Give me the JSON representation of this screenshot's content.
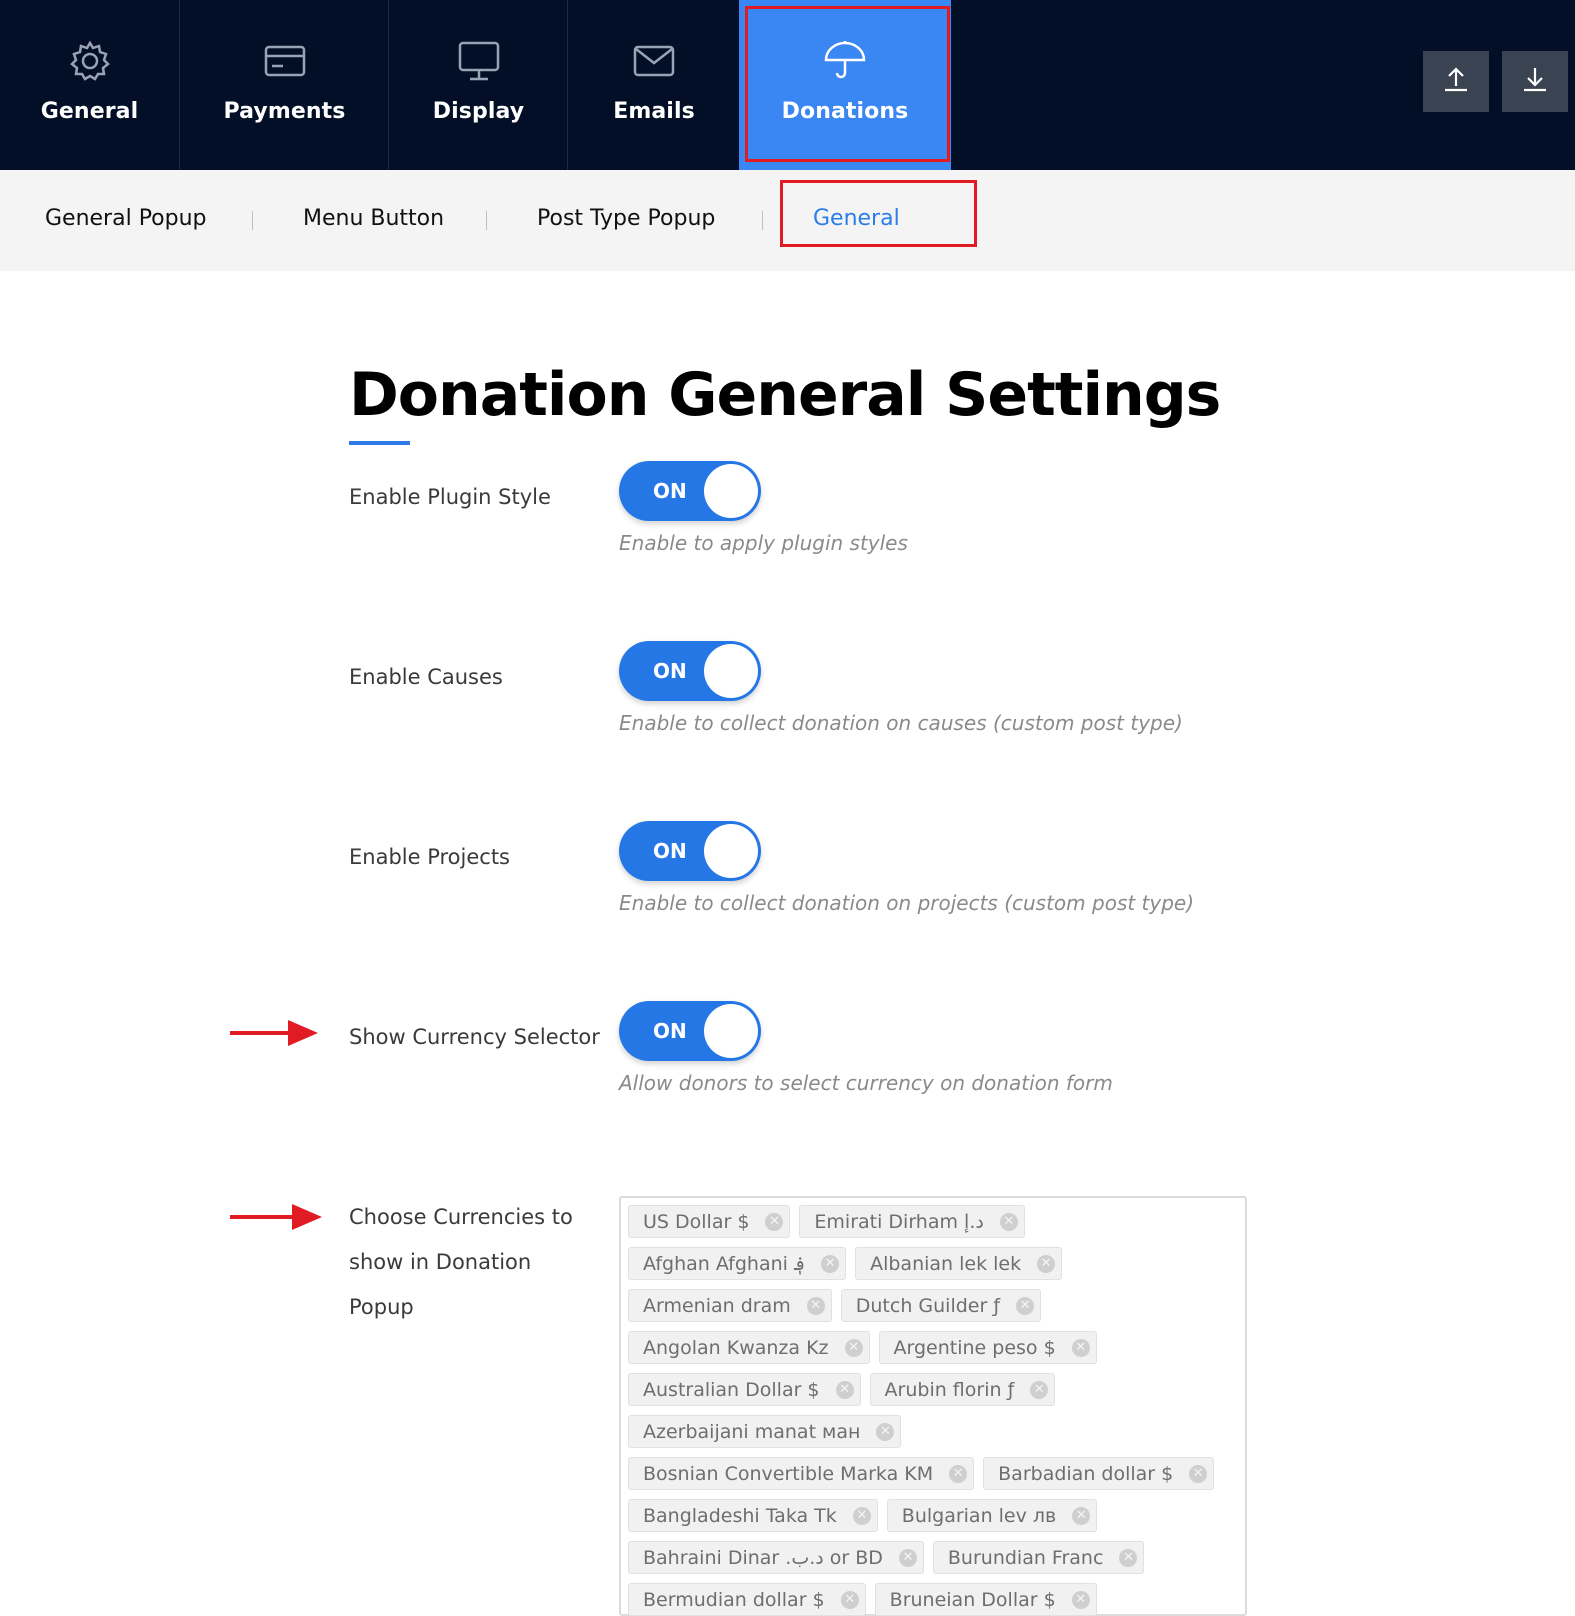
{
  "top_tabs": [
    {
      "label": "General",
      "icon": "gear-icon"
    },
    {
      "label": "Payments",
      "icon": "credit-card-icon"
    },
    {
      "label": "Display",
      "icon": "monitor-icon"
    },
    {
      "label": "Emails",
      "icon": "envelope-icon"
    },
    {
      "label": "Donations",
      "icon": "umbrella-icon",
      "active": true
    }
  ],
  "toolbar": {
    "export_icon": "upload-icon",
    "import_icon": "download-icon"
  },
  "sub_tabs": [
    {
      "label": "General Popup"
    },
    {
      "label": "Menu Button"
    },
    {
      "label": "Post Type Popup"
    },
    {
      "label": "General",
      "active": true
    }
  ],
  "page": {
    "title": "Donation General Settings"
  },
  "settings": [
    {
      "label": "Enable Plugin Style",
      "state": "ON",
      "description": "Enable to apply plugin styles"
    },
    {
      "label": "Enable Causes",
      "state": "ON",
      "description": "Enable to collect donation on causes (custom post type)"
    },
    {
      "label": "Enable Projects",
      "state": "ON",
      "description": "Enable to collect donation on projects (custom post type)"
    },
    {
      "label": "Show Currency Selector",
      "state": "ON",
      "description": "Allow donors to select currency on donation form"
    }
  ],
  "currencies_setting": {
    "label_lines": [
      "Choose Currencies to",
      "show in Donation",
      "Popup"
    ],
    "chips": [
      "US Dollar $",
      "Emirati Dirham د.إ",
      "Afghan Afghani ؋",
      "Albanian lek lek",
      "Armenian dram",
      "Dutch Guilder ƒ",
      "Angolan Kwanza Kz",
      "Argentine peso $",
      "Australian Dollar $",
      "Arubin florin ƒ",
      "Azerbaijani manat ман",
      "Bosnian Convertible Marka KM",
      "Barbadian dollar $",
      "Bangladeshi Taka Tk",
      "Bulgarian lev лв",
      "Bahraini Dinar .د.ب or BD",
      "Burundian Franc",
      "Bermudian dollar $",
      "Bruneian Dollar $"
    ]
  },
  "colors": {
    "nav_bg": "#020f26",
    "accent": "#3a86f2",
    "toggle": "#2677e6",
    "highlight": "#e01b24"
  }
}
